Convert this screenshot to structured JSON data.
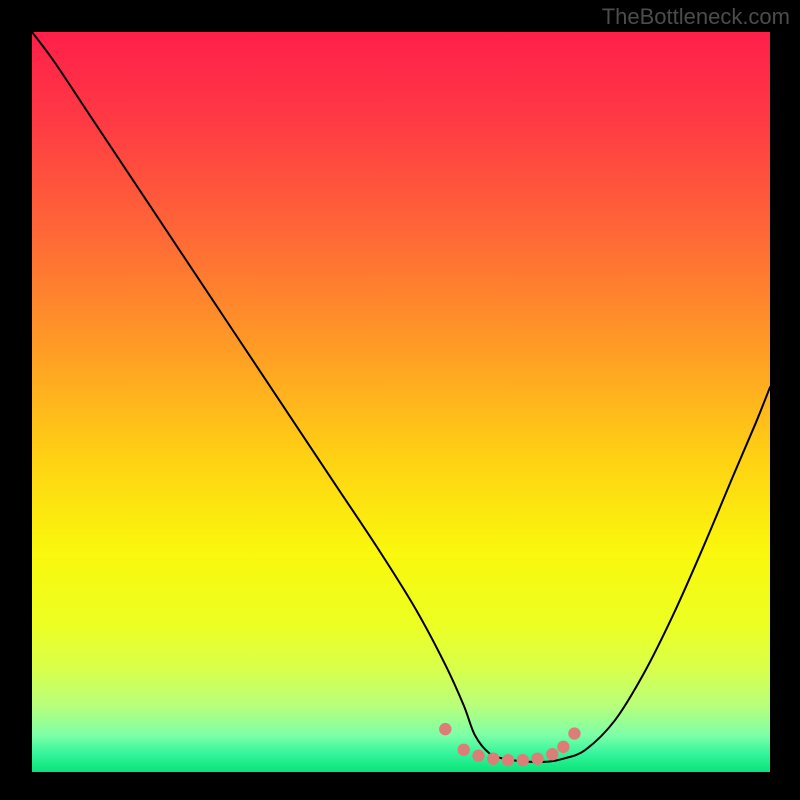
{
  "watermark": "TheBottleneck.com",
  "chart_data": {
    "type": "line",
    "title": "",
    "xlabel": "",
    "ylabel": "",
    "xlim": [
      0,
      100
    ],
    "ylim": [
      0,
      100
    ],
    "background_gradient_stops": [
      {
        "offset": 0.0,
        "color": "#ff1f4a"
      },
      {
        "offset": 0.12,
        "color": "#ff3a44"
      },
      {
        "offset": 0.28,
        "color": "#ff6a36"
      },
      {
        "offset": 0.44,
        "color": "#ffa024"
      },
      {
        "offset": 0.58,
        "color": "#ffd313"
      },
      {
        "offset": 0.7,
        "color": "#faf70c"
      },
      {
        "offset": 0.8,
        "color": "#ecff22"
      },
      {
        "offset": 0.86,
        "color": "#d9ff4b"
      },
      {
        "offset": 0.91,
        "color": "#b8ff7a"
      },
      {
        "offset": 0.95,
        "color": "#7dffa8"
      },
      {
        "offset": 0.975,
        "color": "#35f59b"
      },
      {
        "offset": 1.0,
        "color": "#07e478"
      }
    ],
    "series": [
      {
        "name": "bottleneck-curve",
        "stroke": "#000000",
        "x": [
          0,
          3,
          8,
          14,
          20,
          27,
          34,
          41,
          47,
          52,
          56,
          58.5,
          60,
          62,
          64,
          67,
          70,
          72,
          75,
          79,
          83,
          87,
          91,
          95,
          98,
          100
        ],
        "y": [
          100,
          96,
          88.5,
          79.5,
          70.5,
          60,
          49.5,
          39,
          30,
          22,
          14.5,
          9,
          5,
          2.5,
          1.8,
          1.4,
          1.4,
          1.8,
          3,
          7,
          13.5,
          21.5,
          30.5,
          40,
          47,
          52
        ]
      },
      {
        "name": "optimal-markers",
        "type": "scatter",
        "marker_color": "#dd7d78",
        "x": [
          56,
          58.5,
          60.5,
          62.5,
          64.5,
          66.5,
          68.5,
          70.5,
          72,
          73.5
        ],
        "y": [
          5.8,
          3.0,
          2.2,
          1.8,
          1.6,
          1.6,
          1.8,
          2.4,
          3.4,
          5.2
        ]
      }
    ]
  }
}
